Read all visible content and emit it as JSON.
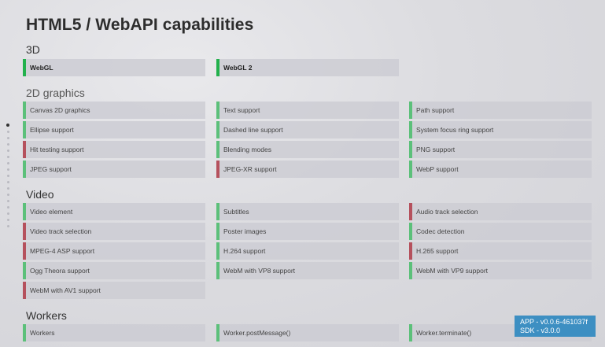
{
  "title": "HTML5 / WebAPI capabilities",
  "sections": {
    "s3d": {
      "title": "3D",
      "items": [
        {
          "label": "WebGL",
          "supported": true
        },
        {
          "label": "WebGL 2",
          "supported": true
        }
      ]
    },
    "s2d": {
      "title": "2D graphics",
      "items": [
        {
          "label": "Canvas 2D graphics",
          "supported": true
        },
        {
          "label": "Text support",
          "supported": true
        },
        {
          "label": "Path support",
          "supported": true
        },
        {
          "label": "Ellipse support",
          "supported": true
        },
        {
          "label": "Dashed line support",
          "supported": true
        },
        {
          "label": "System focus ring support",
          "supported": true
        },
        {
          "label": "Hit testing support",
          "supported": false
        },
        {
          "label": "Blending modes",
          "supported": true
        },
        {
          "label": "PNG support",
          "supported": true
        },
        {
          "label": "JPEG support",
          "supported": true
        },
        {
          "label": "JPEG-XR support",
          "supported": false
        },
        {
          "label": "WebP support",
          "supported": true
        }
      ]
    },
    "video": {
      "title": "Video",
      "items": [
        {
          "label": "Video element",
          "supported": true
        },
        {
          "label": "Subtitles",
          "supported": true
        },
        {
          "label": "Audio track selection",
          "supported": false
        },
        {
          "label": "Video track selection",
          "supported": false
        },
        {
          "label": "Poster images",
          "supported": true
        },
        {
          "label": "Codec detection",
          "supported": true
        },
        {
          "label": "MPEG-4 ASP support",
          "supported": false
        },
        {
          "label": "H.264 support",
          "supported": true
        },
        {
          "label": "H.265 support",
          "supported": false
        },
        {
          "label": "Ogg Theora support",
          "supported": true
        },
        {
          "label": "WebM with VP8 support",
          "supported": true
        },
        {
          "label": "WebM with VP9 support",
          "supported": true
        },
        {
          "label": "WebM with AV1 support",
          "supported": false
        }
      ]
    },
    "workers": {
      "title": "Workers",
      "items": [
        {
          "label": "Workers",
          "supported": true
        },
        {
          "label": "Worker.postMessage()",
          "supported": true
        },
        {
          "label": "Worker.terminate()",
          "supported": true
        }
      ]
    }
  },
  "version": {
    "app": "APP - v0.0.6-461037f",
    "sdk": "SDK - v3.0.0"
  },
  "colors": {
    "supported": "#5cc07a",
    "unsupported": "#b5515d",
    "badge": "#3d8fc2"
  }
}
